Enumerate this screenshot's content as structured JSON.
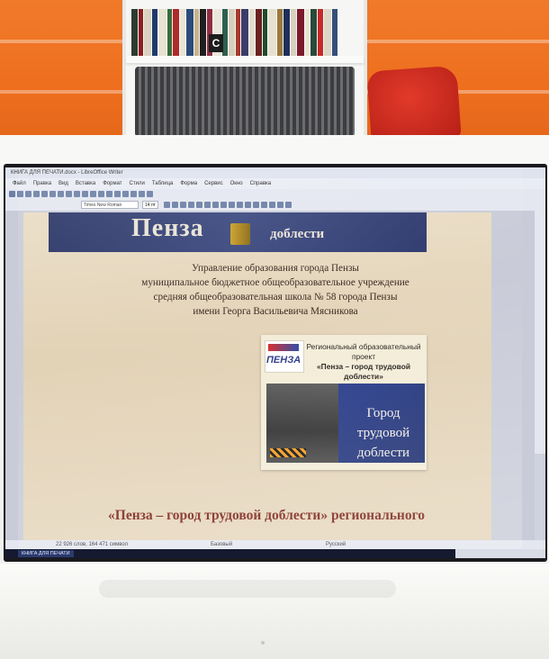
{
  "scene": {
    "shelf_tag": "С"
  },
  "app": {
    "window_title": "КНИГА ДЛЯ ПЕЧАТИ.docx - LibreOffice Writer",
    "menu": [
      "Файл",
      "Правка",
      "Вид",
      "Вставка",
      "Формат",
      "Стили",
      "Таблица",
      "Форма",
      "Сервис",
      "Окно",
      "Справка"
    ],
    "font_name": "Times New Roman",
    "font_size": "14 пт"
  },
  "document": {
    "banner_left": "Пенза",
    "banner_right": "доблести",
    "organization": [
      "Управление образования города Пензы",
      "муниципальное бюджетное общеобразовательное учреждение",
      "средняя общеобразовательная школа № 58 города Пензы",
      "имени Георга Васильевича Мясникова"
    ],
    "card": {
      "logo_text": "ПЕНЗА",
      "project_lines": [
        "Региональный образовательный",
        "проект",
        "«Пенза – город трудовой доблести»"
      ],
      "blue_title_lines": [
        "Город трудовой",
        "доблести"
      ]
    },
    "heading": "«Пенза – город трудовой доблести» регионального"
  },
  "status": {
    "words": "22 926 слов, 164 471 символ",
    "style": "Базовый",
    "language": "Русский"
  },
  "taskbar": {
    "item": "КНИГА ДЛЯ ПЕЧАТИ"
  },
  "colors": {
    "wall": "#ee6f1e",
    "banner": "#2a3566",
    "heading": "#7a2218",
    "blue_card": "#283c8c"
  }
}
